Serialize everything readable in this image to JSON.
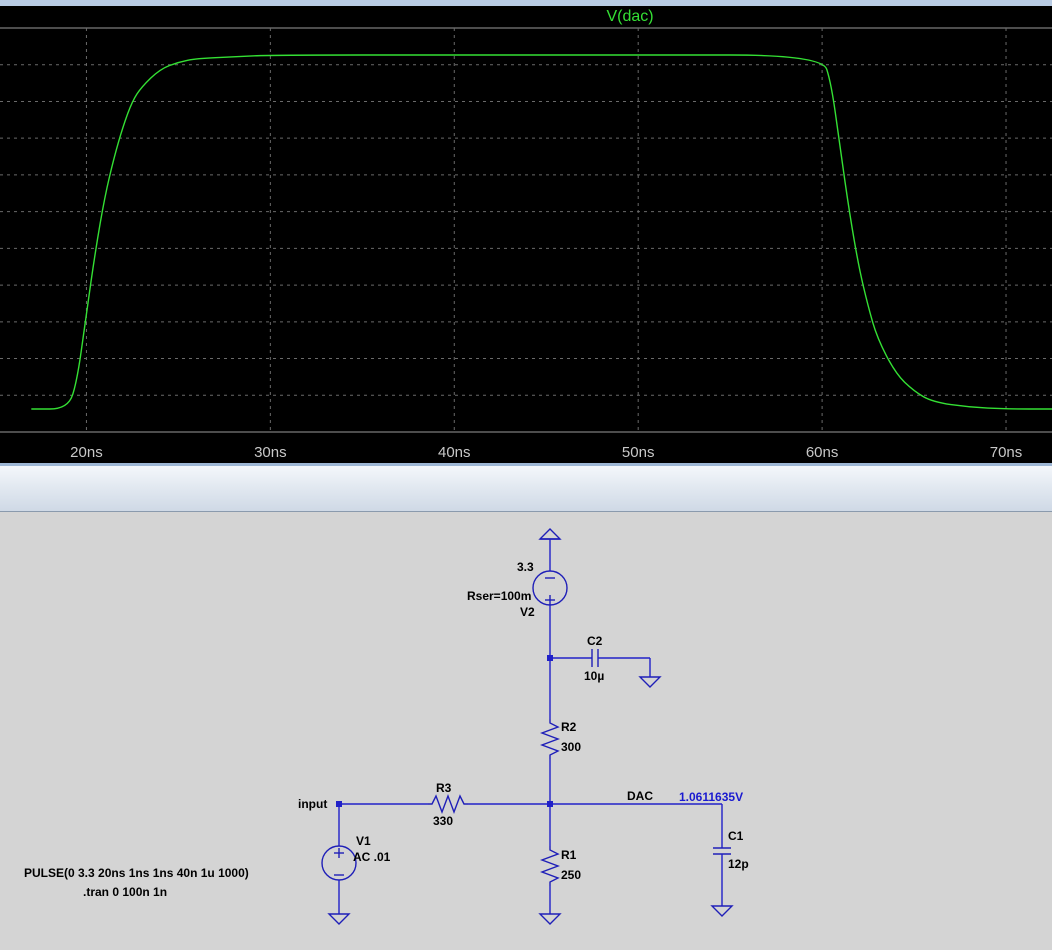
{
  "waveform": {
    "trace_name": "V(dac)",
    "trace_color": "#34e034",
    "x_ticks": [
      "20ns",
      "30ns",
      "40ns",
      "50ns",
      "60ns",
      "70ns"
    ]
  },
  "chart_data": {
    "type": "line",
    "title": "V(dac)",
    "xlabel": "",
    "ylabel": "",
    "series": [
      {
        "name": "V(dac)",
        "x_ns": [
          17,
          19,
          19.5,
          20,
          20.5,
          21,
          21.5,
          22,
          22.5,
          23,
          24,
          25,
          26,
          28,
          30,
          40,
          50,
          60,
          60.5,
          61,
          61.5,
          62,
          62.5,
          63,
          64,
          65,
          66,
          68,
          70,
          72.5
        ],
        "y_rel": [
          0,
          0,
          0.08,
          0.27,
          0.45,
          0.6,
          0.71,
          0.8,
          0.87,
          0.91,
          0.96,
          0.98,
          0.99,
          0.995,
          1,
          1,
          1,
          1,
          0.92,
          0.73,
          0.55,
          0.4,
          0.29,
          0.2,
          0.1,
          0.05,
          0.02,
          0.005,
          0,
          0
        ]
      }
    ],
    "x_range_ns": [
      15.3,
      72.5
    ],
    "grid": true
  },
  "schematic": {
    "v2_value": "3.3",
    "v2_rser": "Rser=100m",
    "v2_name": "V2",
    "c2_name": "C2",
    "c2_value": "10µ",
    "r2_name": "R2",
    "r2_value": "300",
    "r3_name": "R3",
    "r3_value": "330",
    "r1_name": "R1",
    "r1_value": "250",
    "c1_name": "C1",
    "c1_value": "12p",
    "v1_name": "V1",
    "v1_ac": "AC .01",
    "net_input": "input",
    "net_dac": "DAC",
    "dac_voltage": "1.0611635V",
    "pulse_directive": "PULSE(0 3.3 20ns 1ns 1ns 40n 1u 1000)",
    "tran_directive": ".tran 0 100n 1n",
    "wire_color": "#2121c8",
    "probe_color": "#1a1ad0"
  }
}
